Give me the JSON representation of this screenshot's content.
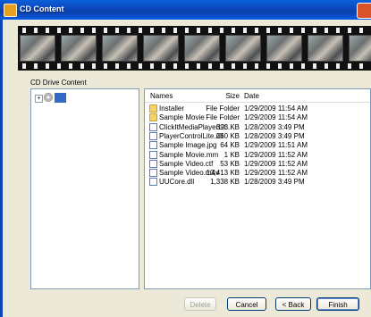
{
  "window": {
    "title": "CD Content"
  },
  "content_label": "CD Drive Content",
  "table": {
    "headers": {
      "name": "Names",
      "size": "Size",
      "date": "Date"
    },
    "rows": [
      {
        "icon": "folder-icon",
        "name": "Installer",
        "size": "File Folder",
        "date": "1/29/2009 11:54 AM"
      },
      {
        "icon": "folder-icon",
        "name": "Sample Movie",
        "size": "File Folder",
        "date": "1/29/2009 11:54 AM"
      },
      {
        "icon": "file-icon",
        "name": "ClickItMediaPlayerLit...",
        "size": "393 KB",
        "date": "1/28/2009 3:49 PM"
      },
      {
        "icon": "file-icon",
        "name": "PlayerControlLite.dll",
        "size": "260 KB",
        "date": "1/28/2009 3:49 PM"
      },
      {
        "icon": "file-icon",
        "name": "Sample Image.jpg",
        "size": "64 KB",
        "date": "1/29/2009 11:51 AM"
      },
      {
        "icon": "file-icon",
        "name": "Sample Movie.mm",
        "size": "1 KB",
        "date": "1/29/2009 11:52 AM"
      },
      {
        "icon": "file-icon",
        "name": "Sample Video.ctf",
        "size": "53 KB",
        "date": "1/29/2009 11:52 AM"
      },
      {
        "icon": "file-icon",
        "name": "Sample Video.m4v",
        "size": "13,413 KB",
        "date": "1/29/2009 11:52 AM"
      },
      {
        "icon": "file-icon",
        "name": "UUCore.dll",
        "size": "1,338 KB",
        "date": "1/28/2009 3:49 PM"
      }
    ]
  },
  "buttons": {
    "delete": "Delete",
    "cancel": "Cancel",
    "back": "< Back",
    "finish": "Finish"
  }
}
